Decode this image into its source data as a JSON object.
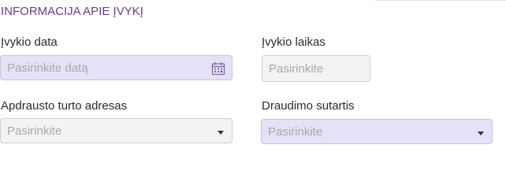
{
  "section": {
    "title": "INFORMACIJA APIE ĮVYKĮ"
  },
  "fields": {
    "event_date": {
      "label": "Įvykio data",
      "placeholder": "Pasirinkite datą",
      "icon": "calendar-icon"
    },
    "event_time": {
      "label": "Įvykio laikas",
      "placeholder": "Pasirinkite"
    },
    "insured_address": {
      "label": "Apdrausto turto adresas",
      "placeholder": "Pasirinkite",
      "icon": "chevron-down-icon"
    },
    "insurance_contract": {
      "label": "Draudimo sutartis",
      "placeholder": "Pasirinkite",
      "icon": "chevron-down-icon"
    }
  },
  "colors": {
    "title": "#6b3d8f",
    "purple_field": "#e6e1f7",
    "grey_field": "#f3f4f1",
    "calendar_icon": "#7a6aa8"
  }
}
